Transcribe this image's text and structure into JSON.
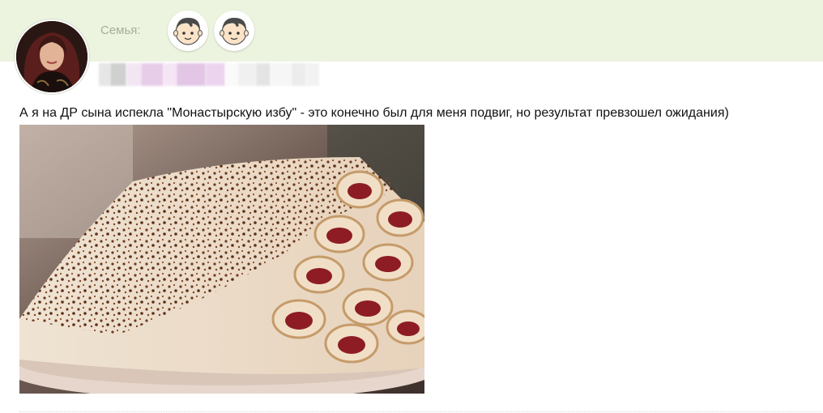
{
  "header": {
    "family_label": "Семья:",
    "children": [
      {
        "icon": "boy-face-icon"
      },
      {
        "icon": "boy-face-icon"
      }
    ]
  },
  "post": {
    "text": "А я на ДР сына испекла \"Монастырскую избу\" - это конечно был для меня подвиг, но результат превзошел ожидания)"
  },
  "colors": {
    "header_band": "#ecf4df",
    "label": "#a7ad9e",
    "text": "#111111"
  }
}
